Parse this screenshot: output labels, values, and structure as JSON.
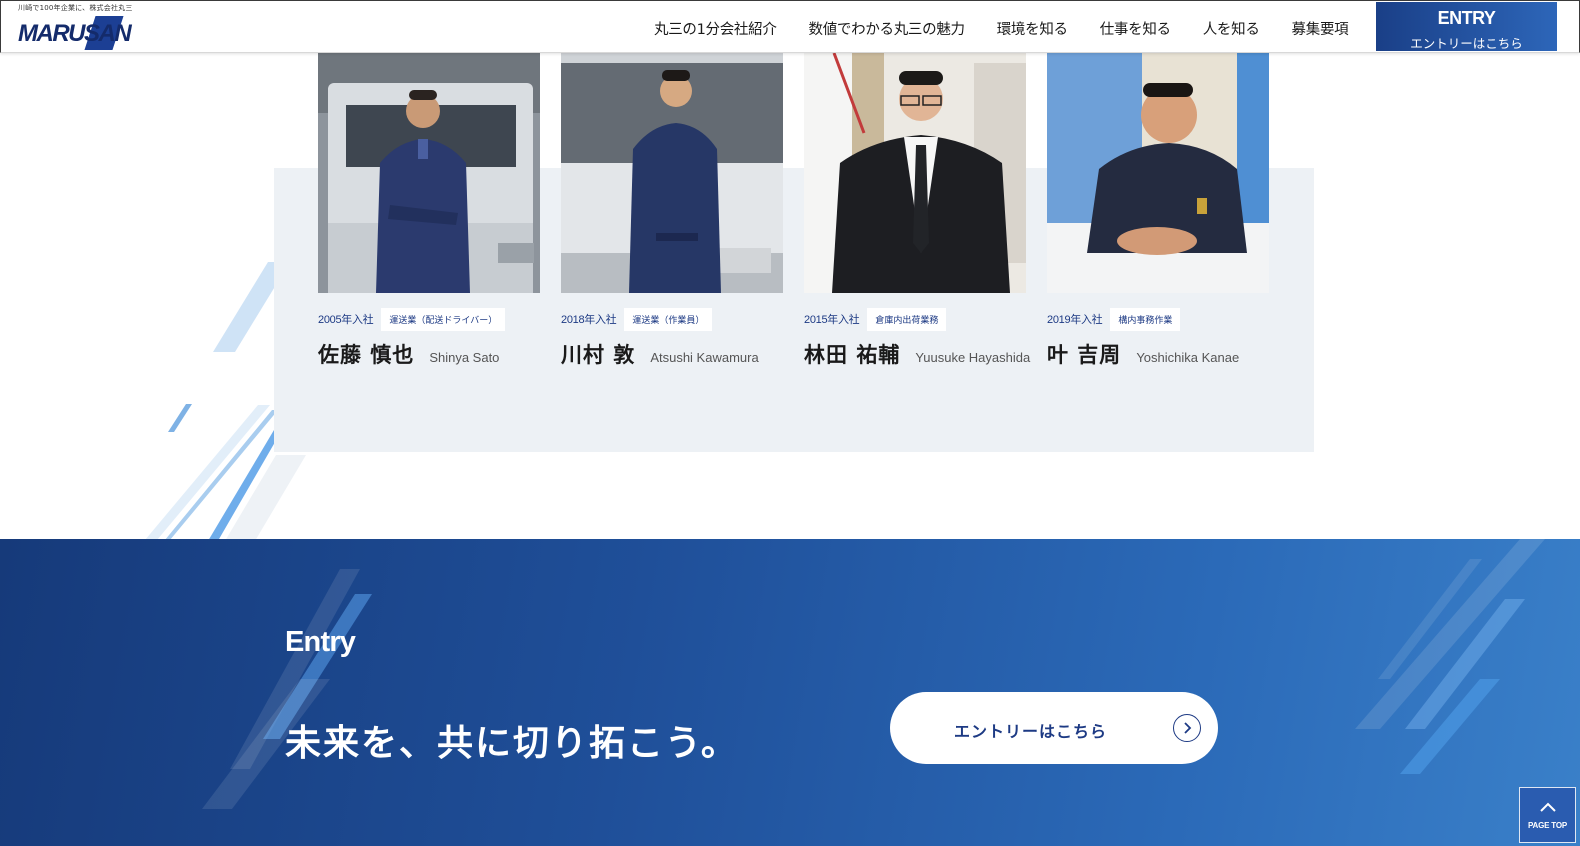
{
  "header": {
    "tagline": "川崎で100年企業に、株式会社丸三",
    "logo_text": "MARUSAN",
    "nav": [
      "丸三の1分会社紹介",
      "数値でわかる丸三の魅力",
      "環境を知る",
      "仕事を知る",
      "人を知る",
      "募集要項"
    ],
    "entry_button": {
      "en": "ENTRY",
      "ja": "エントリーはこちら"
    }
  },
  "staff": [
    {
      "year": "2005年入社",
      "dept": "運送業（配送ドライバー）",
      "name_ja": "佐藤 慎也",
      "name_en": "Shinya Sato"
    },
    {
      "year": "2018年入社",
      "dept": "運送業（作業員）",
      "name_ja": "川村 敦",
      "name_en": "Atsushi Kawamura"
    },
    {
      "year": "2015年入社",
      "dept": "倉庫内出荷業務",
      "name_ja": "林田 祐輔",
      "name_en": "Yuusuke Hayashida"
    },
    {
      "year": "2019年入社",
      "dept": "構内事務作業",
      "name_ja": "叶 吉周",
      "name_en": "Yoshichika Kanae"
    }
  ],
  "entry_section": {
    "label": "Entry",
    "heading": "未来を、共に切り拓こう。",
    "cta_label": "エントリーはこちら"
  },
  "page_top": {
    "label": "PAGE TOP"
  },
  "colors": {
    "brand_navy": "#142b6b",
    "accent_blue": "#1d3a84",
    "panel_bg": "#edf1f5",
    "entry_gradient_start": "#163a7a",
    "entry_gradient_end": "#3a80c9"
  }
}
